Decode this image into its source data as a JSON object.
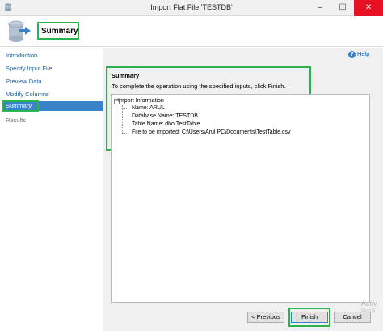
{
  "window": {
    "title": "Import Flat File 'TESTDB'",
    "minimize": "–",
    "maximize": "☐",
    "close": "✕"
  },
  "header": {
    "title": "Summary"
  },
  "sidebar": {
    "items": [
      {
        "label": "Introduction"
      },
      {
        "label": "Specify Input File"
      },
      {
        "label": "Preview Data"
      },
      {
        "label": "Modify Columns"
      },
      {
        "label": "Summary"
      },
      {
        "label": "Results"
      }
    ]
  },
  "help": {
    "label": "Help"
  },
  "summary": {
    "title": "Summary",
    "description": "To complete the operation using the specified inputs, click Finish.",
    "tree": {
      "root": "Import Information",
      "items": [
        "Name: ARUL",
        "Database Name: TESTDB",
        "Table Name: dbo.TestTable",
        "File to be imported: C:\\Users\\Arul PC\\Documents\\TestTable.csv"
      ]
    }
  },
  "buttons": {
    "previous": "< Previous",
    "finish": "Finish",
    "cancel": "Cancel"
  },
  "watermark": {
    "line1": "Activ",
    "line2": "Go to S"
  },
  "colors": {
    "accent": "#3a83c9",
    "highlight": "#2ab34a",
    "link": "#1d5fa8"
  }
}
